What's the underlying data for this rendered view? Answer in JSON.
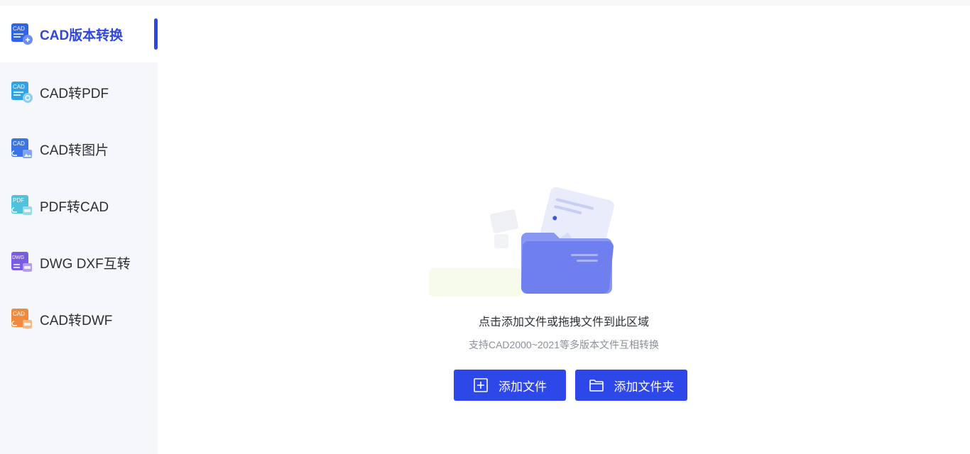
{
  "sidebar": {
    "items": [
      {
        "label": "CAD版本转换",
        "icon": "cad-version-icon",
        "active": true
      },
      {
        "label": "CAD转PDF",
        "icon": "cad-to-pdf-icon",
        "active": false
      },
      {
        "label": "CAD转图片",
        "icon": "cad-to-image-icon",
        "active": false
      },
      {
        "label": "PDF转CAD",
        "icon": "pdf-to-cad-icon",
        "active": false
      },
      {
        "label": "DWG DXF互转",
        "icon": "dwg-dxf-icon",
        "active": false
      },
      {
        "label": "CAD转DWF",
        "icon": "cad-to-dwf-icon",
        "active": false
      }
    ],
    "icon_badges": {
      "cad": "CAD",
      "pdf": "PDF",
      "dwg": "DWG"
    }
  },
  "dropzone": {
    "title": "点击添加文件或拖拽文件到此区域",
    "subtitle": "支持CAD2000~2021等多版本文件互相转换"
  },
  "buttons": {
    "add_file": "添加文件",
    "add_folder": "添加文件夹"
  },
  "colors": {
    "accent": "#2d47e0",
    "button": "#2d47e8",
    "sidebar_bg": "#f5f7fa"
  }
}
